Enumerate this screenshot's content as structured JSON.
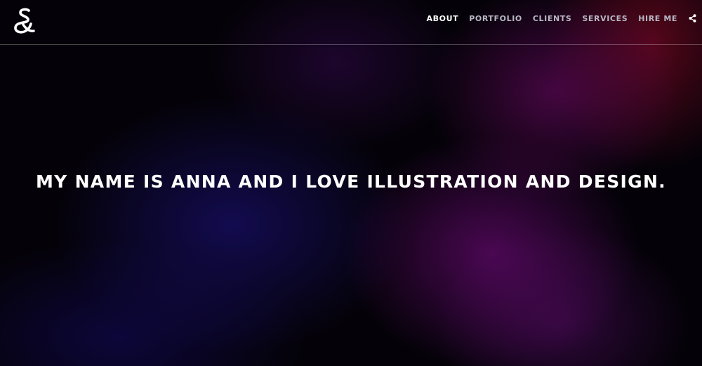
{
  "header": {
    "logo_icon": "ampersand-logo-icon",
    "nav": [
      {
        "label": "ABOUT",
        "active": true
      },
      {
        "label": "PORTFOLIO",
        "active": false
      },
      {
        "label": "CLIENTS",
        "active": false
      },
      {
        "label": "SERVICES",
        "active": false
      },
      {
        "label": "HIRE ME",
        "active": false
      }
    ],
    "share_icon": "share-icon"
  },
  "hero": {
    "title": "MY NAME IS ANNA AND I LOVE ILLUSTRATION AND DESIGN."
  },
  "colors": {
    "background": "#040208",
    "text": "#ffffff",
    "nav_inactive": "#b8b8c4",
    "divider": "#4a4a52",
    "glow_purple": "#7a0a7a",
    "glow_blue": "#1a0f6e",
    "glow_red": "#960a28"
  }
}
